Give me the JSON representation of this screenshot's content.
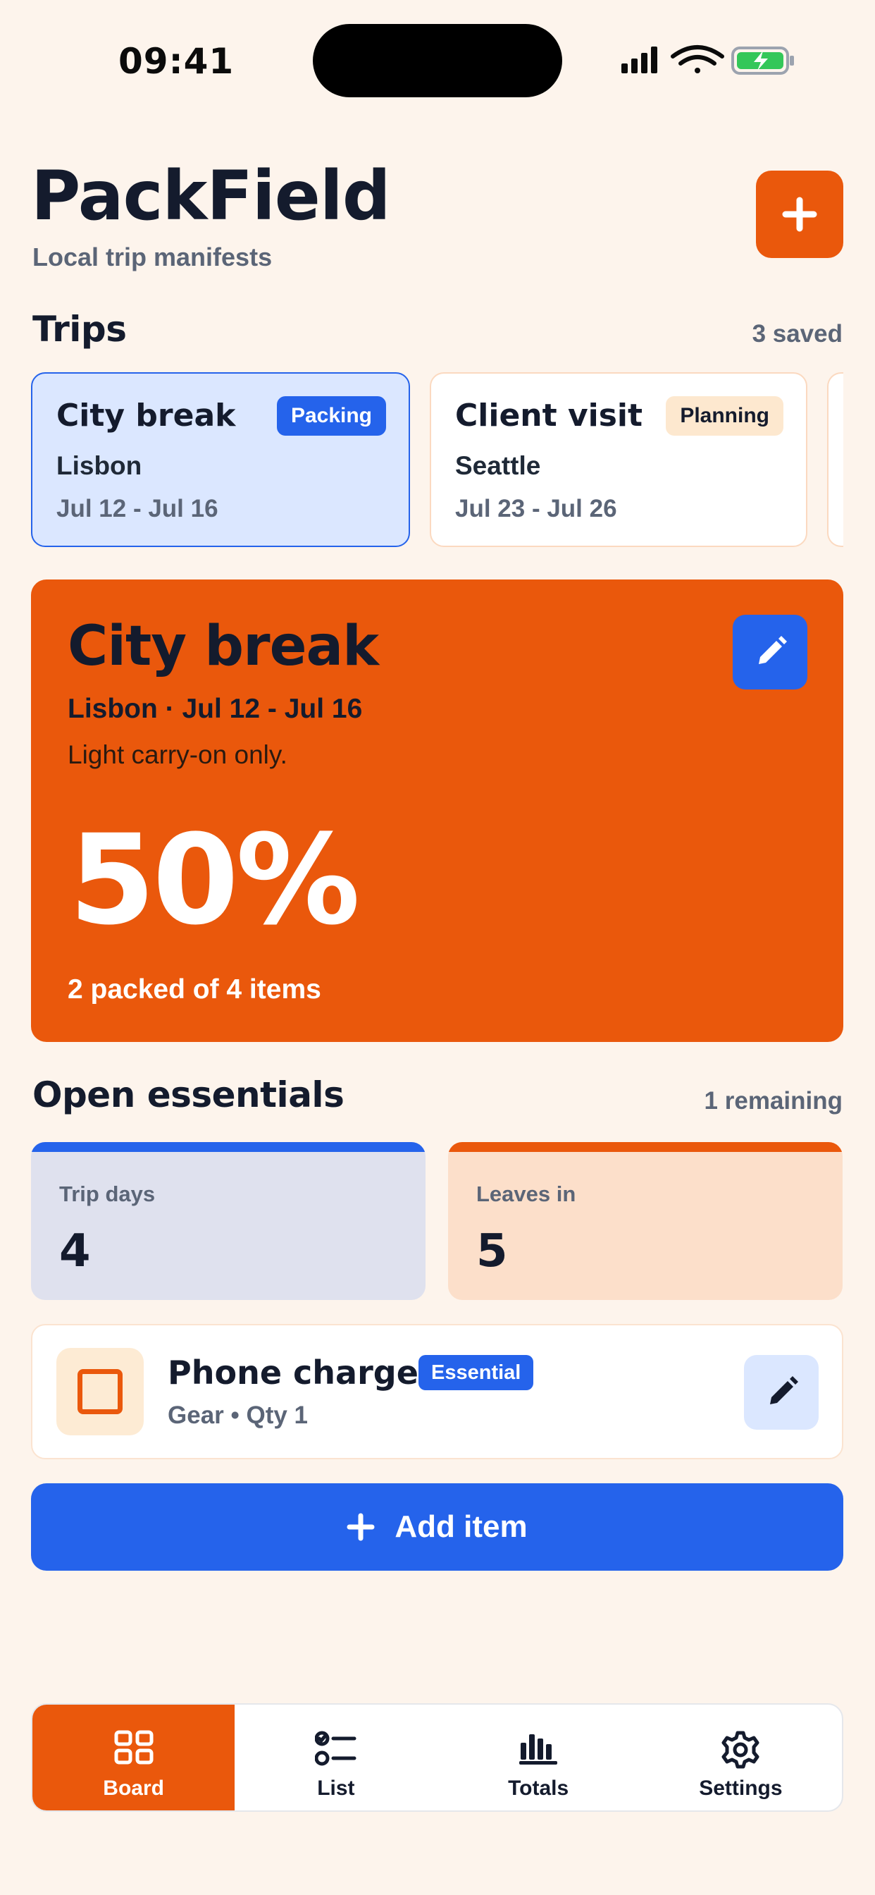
{
  "status_bar": {
    "time": "09:41"
  },
  "header": {
    "title": "PackField",
    "subtitle": "Local trip manifests"
  },
  "trips_section": {
    "title": "Trips",
    "meta": "3 saved",
    "trips": [
      {
        "name": "City break",
        "status": "Packing",
        "city": "Lisbon",
        "dates": "Jul 12 - Jul 16"
      },
      {
        "name": "Client visit",
        "status": "Planning",
        "city": "Seattle",
        "dates": "Jul 23 - Jul 26"
      }
    ]
  },
  "hero": {
    "title": "City break",
    "meta": "Lisbon · Jul 12 - Jul 16",
    "note": "Light carry-on only.",
    "percent": "50%",
    "count": "2 packed of 4 items"
  },
  "essentials": {
    "title": "Open essentials",
    "meta": "1 remaining",
    "stats": [
      {
        "label": "Trip days",
        "value": "4"
      },
      {
        "label": "Leaves in",
        "value": "5"
      }
    ],
    "item": {
      "name": "Phone charger",
      "badge": "Essential",
      "meta": "Gear • Qty 1"
    }
  },
  "add_item_label": "Add item",
  "tabs": [
    {
      "label": "Board",
      "icon": "grid-icon"
    },
    {
      "label": "List",
      "icon": "checklist-icon"
    },
    {
      "label": "Totals",
      "icon": "bar-chart-icon"
    },
    {
      "label": "Settings",
      "icon": "gear-icon"
    }
  ],
  "colors": {
    "accent": "#ea580c",
    "primary": "#2563eb",
    "background": "#fdf4ec"
  }
}
